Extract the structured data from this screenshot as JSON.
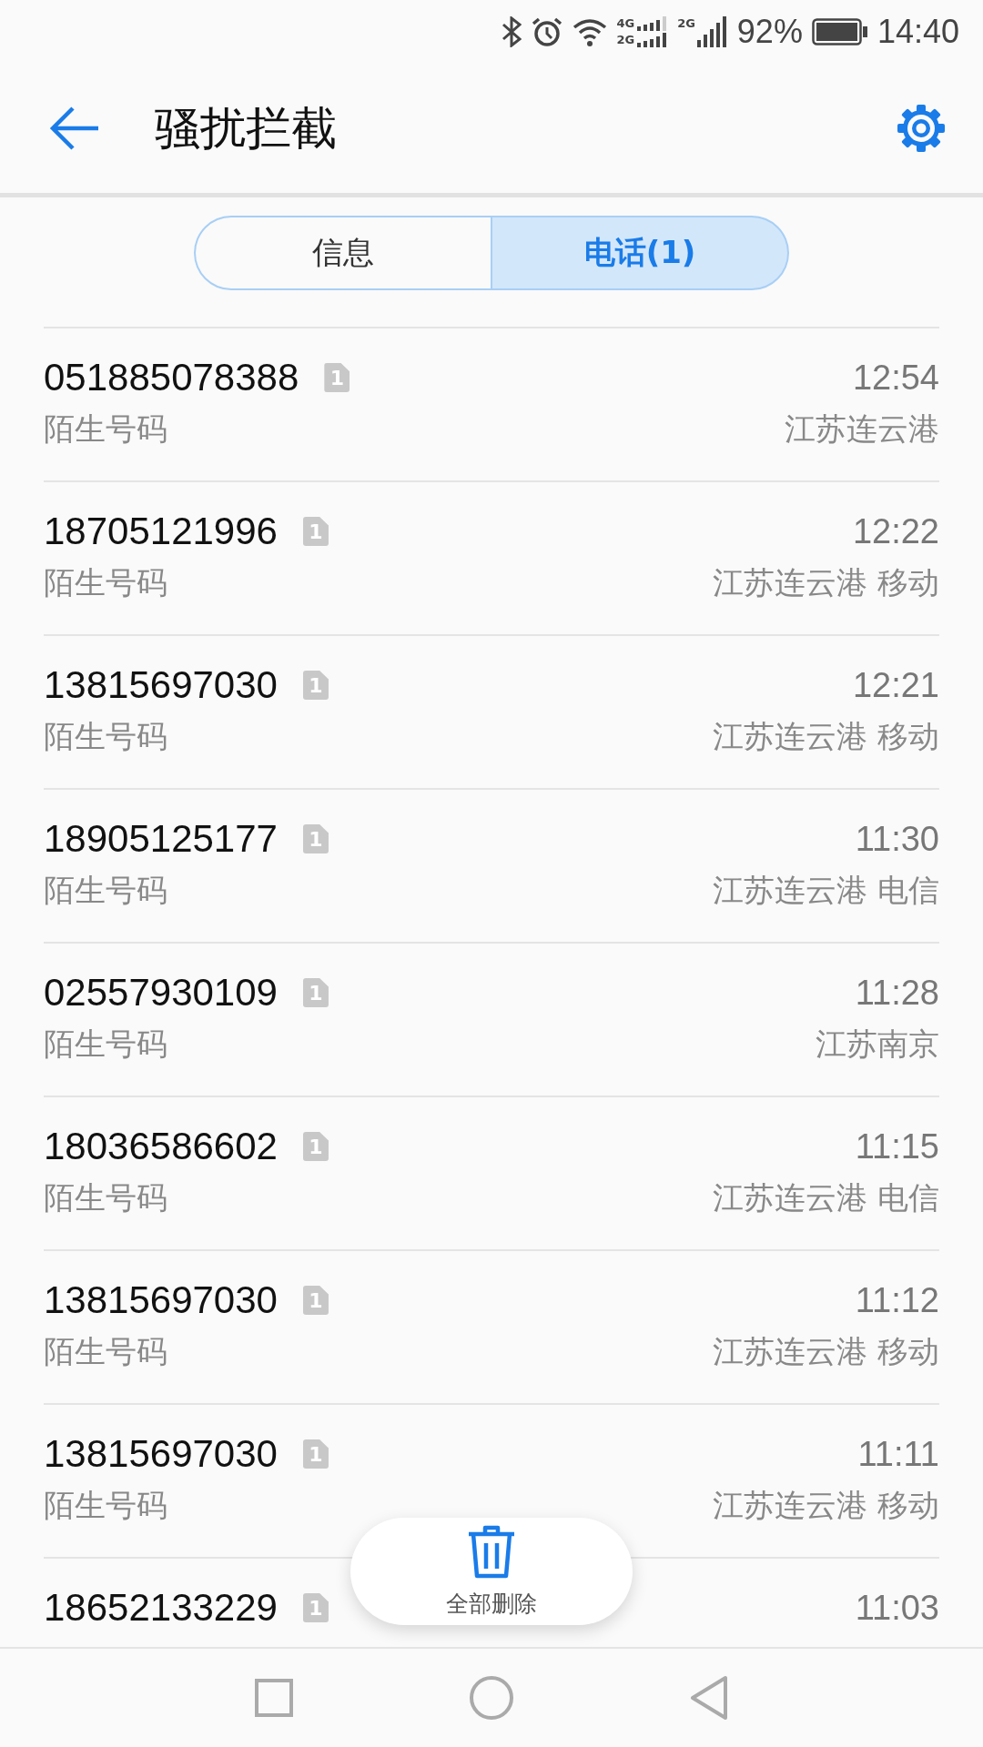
{
  "status_bar": {
    "sim1_networks": [
      "4G",
      "2G"
    ],
    "sim2_network": "2G",
    "battery": "92%",
    "time": "14:40"
  },
  "header": {
    "title": "骚扰拦截"
  },
  "tabs": [
    {
      "label": "信息",
      "selected": false
    },
    {
      "label": "电话(1)",
      "selected": true
    }
  ],
  "calls": [
    {
      "number": "051885078388",
      "sim": "1",
      "label": "陌生号码",
      "time": "12:54",
      "location": "江苏连云港"
    },
    {
      "number": "18705121996",
      "sim": "1",
      "label": "陌生号码",
      "time": "12:22",
      "location": "江苏连云港 移动"
    },
    {
      "number": "13815697030",
      "sim": "1",
      "label": "陌生号码",
      "time": "12:21",
      "location": "江苏连云港 移动"
    },
    {
      "number": "18905125177",
      "sim": "1",
      "label": "陌生号码",
      "time": "11:30",
      "location": "江苏连云港 电信"
    },
    {
      "number": "02557930109",
      "sim": "1",
      "label": "陌生号码",
      "time": "11:28",
      "location": "江苏南京"
    },
    {
      "number": "18036586602",
      "sim": "1",
      "label": "陌生号码",
      "time": "11:15",
      "location": "江苏连云港 电信"
    },
    {
      "number": "13815697030",
      "sim": "1",
      "label": "陌生号码",
      "time": "11:12",
      "location": "江苏连云港 移动"
    },
    {
      "number": "13815697030",
      "sim": "1",
      "label": "陌生号码",
      "time": "11:11",
      "location": "江苏连云港 移动"
    },
    {
      "number": "18652133229",
      "sim": "1",
      "time": "11:03"
    }
  ],
  "delete_all": {
    "label": "全部删除"
  }
}
